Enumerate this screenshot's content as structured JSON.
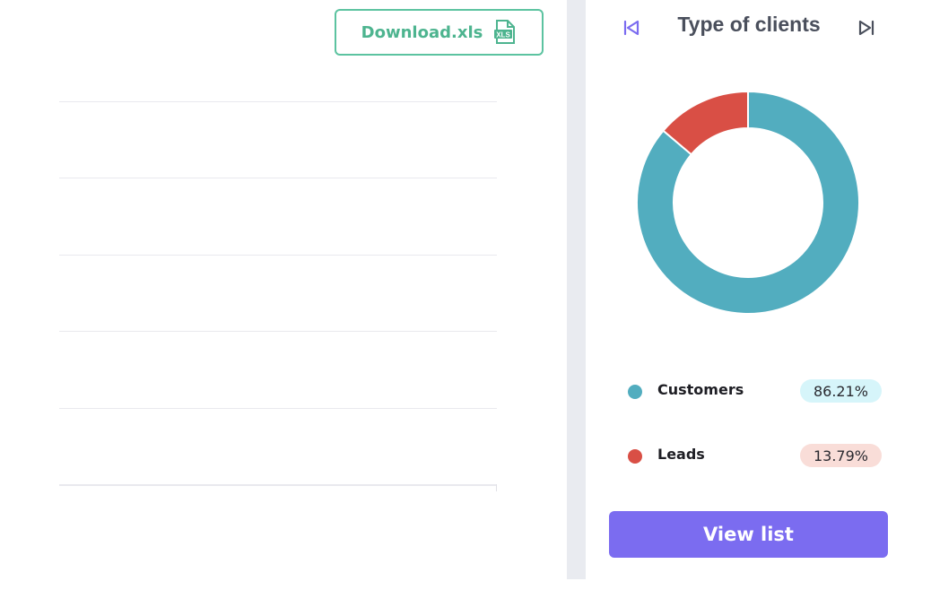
{
  "toolbar": {
    "download_label": "Download.xls",
    "download_icon": "xls-file-icon",
    "xls_icon_text": "XLS"
  },
  "panel": {
    "title": "Type of clients",
    "prev_icon": "skip-previous-icon",
    "next_icon": "skip-next-icon",
    "view_list_label": "View list"
  },
  "chart_data": {
    "type": "pie",
    "title": "Type of clients",
    "categories": [
      "Customers",
      "Leads"
    ],
    "values": [
      86.21,
      13.79
    ],
    "value_labels": [
      "86.21%",
      "13.79%"
    ],
    "colors": [
      "#52adbf",
      "#d94f45"
    ],
    "pill_colors": [
      "#d6f5fa",
      "#f9ddd8"
    ],
    "donut": true
  },
  "colors": {
    "accent": "#7b6cf0",
    "download_green": "#4db48f"
  }
}
